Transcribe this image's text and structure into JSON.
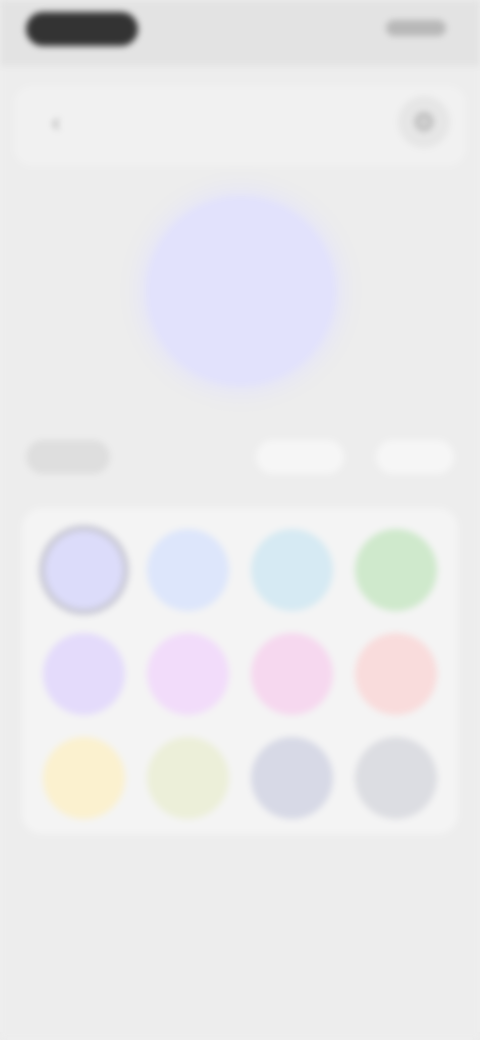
{
  "header": {
    "back_icon_glyph": "‹",
    "settings_icon_glyph": "⚙"
  },
  "preview": {
    "color": "#e2e2fc"
  },
  "tabs": [
    {
      "label": "",
      "active": true
    },
    {
      "label": "",
      "active": false
    },
    {
      "label": "",
      "active": false
    },
    {
      "label": "",
      "active": false
    }
  ],
  "palette": {
    "selected_index": 0,
    "swatches": [
      "#dcdcfa",
      "#dde6fb",
      "#d6eaf3",
      "#cfe9cc",
      "#e4dbfb",
      "#f2dcfa",
      "#f6d8ef",
      "#f9dcdc",
      "#fbf1cf",
      "#ecefd9",
      "#d7d9e6",
      "#dcdde2"
    ]
  },
  "icons": {
    "back": "chevron-left-icon",
    "settings": "gear-icon"
  }
}
